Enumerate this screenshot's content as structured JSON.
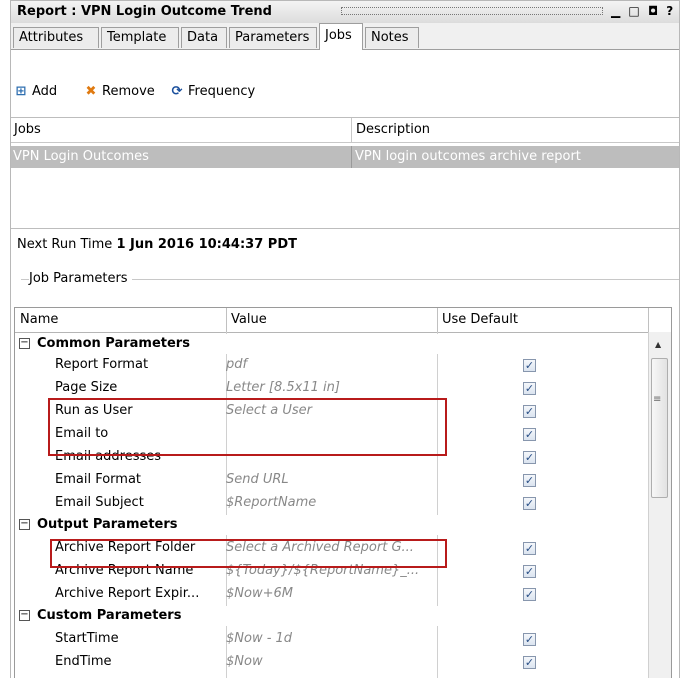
{
  "window": {
    "title": "Report : VPN Login Outcome Trend",
    "help_glyph": "?"
  },
  "tabs": [
    {
      "label": "Attributes"
    },
    {
      "label": "Template"
    },
    {
      "label": "Data"
    },
    {
      "label": "Parameters"
    },
    {
      "label": "Jobs",
      "active": true
    },
    {
      "label": "Notes"
    }
  ],
  "toolbar": {
    "add_label": "Add",
    "remove_label": "Remove",
    "frequency_label": "Frequency"
  },
  "jobs_table": {
    "columns": [
      "Jobs",
      "Description"
    ],
    "rows": [
      {
        "job": "VPN Login Outcomes",
        "description": "VPN login outcomes archive report",
        "selected": true
      }
    ]
  },
  "next_run": {
    "label": "Next Run Time",
    "value": "1 Jun 2016 10:44:37 PDT"
  },
  "job_parameters": {
    "legend": "Job Parameters",
    "columns": [
      "Name",
      "Value",
      "Use Default"
    ],
    "sections": {
      "common": {
        "label": "Common Parameters",
        "rows": [
          {
            "name": "Report Format",
            "value": "pdf",
            "use_default": true
          },
          {
            "name": "Page Size",
            "value": "Letter [8.5x11 in]",
            "use_default": true
          },
          {
            "name": "Run as User",
            "value": "Select a User",
            "use_default": true
          },
          {
            "name": "Email to",
            "value": "",
            "use_default": true
          },
          {
            "name": "Email addresses",
            "value": "",
            "use_default": true
          },
          {
            "name": "Email Format",
            "value": "Send URL",
            "use_default": true
          },
          {
            "name": "Email Subject",
            "value": "$ReportName",
            "use_default": true
          }
        ]
      },
      "output": {
        "label": "Output Parameters",
        "rows": [
          {
            "name": "Archive Report Folder",
            "value": "Select a Archived Report G...",
            "use_default": true
          },
          {
            "name": "Archive Report Name",
            "value": "${Today}/${ReportName}_...",
            "use_default": true
          },
          {
            "name": "Archive Report Expir...",
            "value": "$Now+6M",
            "use_default": true
          }
        ]
      },
      "custom": {
        "label": "Custom Parameters",
        "rows": [
          {
            "name": "StartTime",
            "value": "$Now - 1d",
            "use_default": true
          },
          {
            "name": "EndTime",
            "value": "$Now",
            "use_default": true
          }
        ]
      }
    }
  },
  "colors": {
    "highlight_border": "#b81b1b",
    "selected_row": "#bdbdbd"
  }
}
